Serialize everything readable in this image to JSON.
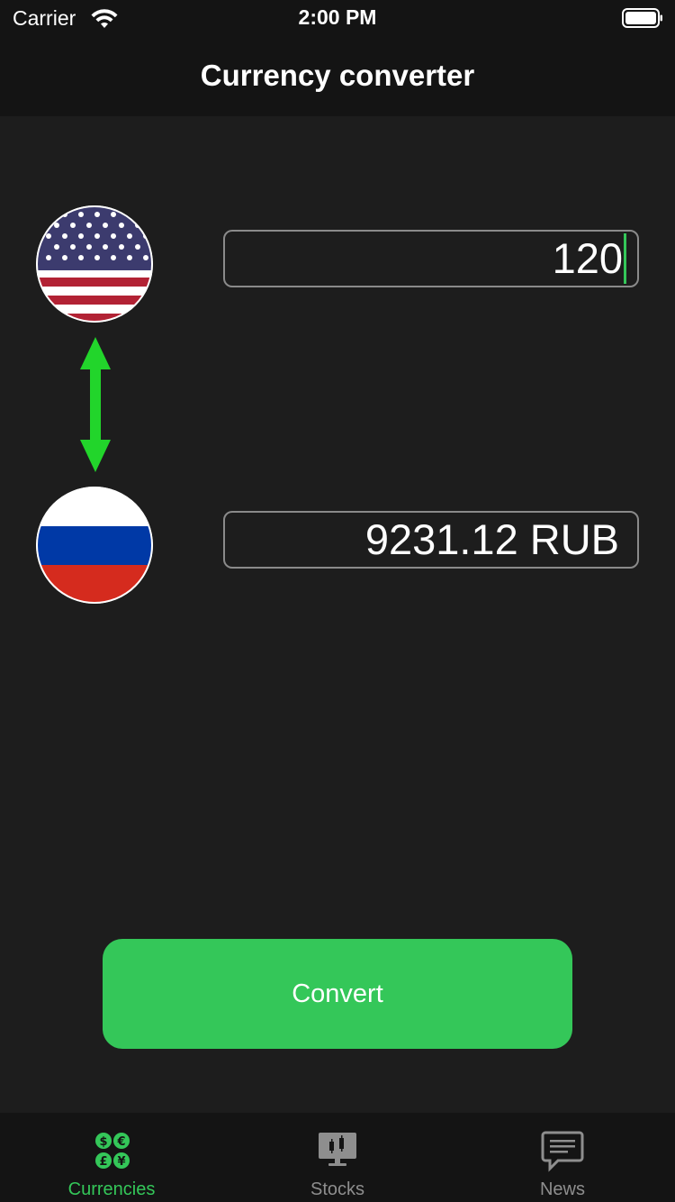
{
  "status_bar": {
    "carrier": "Carrier",
    "time": "2:00 PM",
    "icons": [
      "wifi-icon",
      "battery-icon"
    ]
  },
  "nav": {
    "title": "Currency converter"
  },
  "converter": {
    "from": {
      "flag": "usa-flag-icon",
      "value": "120"
    },
    "to": {
      "flag": "russia-flag-icon",
      "value": "9231.12 RUB"
    },
    "swap_icon": "swap-arrows-icon"
  },
  "convert_button": {
    "label": "Convert"
  },
  "tabs": [
    {
      "label": "Currencies",
      "icon": "currencies-icon",
      "selected": true
    },
    {
      "label": "Stocks",
      "icon": "stocks-chart-icon",
      "selected": false
    },
    {
      "label": "News",
      "icon": "news-bubble-icon",
      "selected": false
    }
  ],
  "colors": {
    "accent": "#34c759",
    "background": "#1d1d1d",
    "bars": "#141414",
    "field_border": "#8a8a8a",
    "inactive_tab": "#8e8e8e",
    "arrow": "#22d52b"
  }
}
